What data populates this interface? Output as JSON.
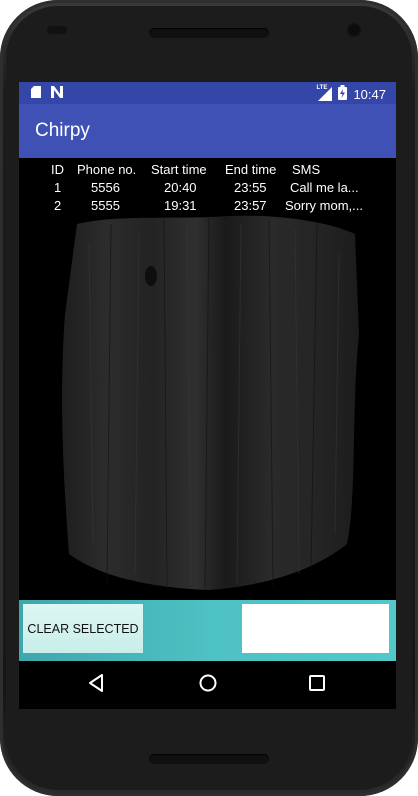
{
  "status_bar": {
    "time": "10:47",
    "icons": [
      "sd-card-icon",
      "notification-n-icon",
      "lte-signal-icon",
      "battery-charging-icon"
    ],
    "lte_label": "LTE"
  },
  "app_bar": {
    "title": "Chirpy"
  },
  "table": {
    "headers": [
      "ID",
      "Phone no.",
      "Start time",
      "End time",
      "SMS"
    ],
    "rows": [
      [
        "1",
        "5556",
        "20:40",
        "23:55",
        "Call me la..."
      ],
      [
        "2",
        "5555",
        "19:31",
        "23:57",
        "Sorry mom,..."
      ]
    ]
  },
  "bottom_bar": {
    "clear_selected_label": "CLEAR SELECTED"
  },
  "nav_bar": {
    "icons": [
      "back-icon",
      "home-icon",
      "recents-icon"
    ]
  },
  "colors": {
    "status_bar": "#3446a8",
    "app_bar": "#3f51b5",
    "bottom_bar": "#4dc1c3",
    "screen_bg": "#000000"
  }
}
